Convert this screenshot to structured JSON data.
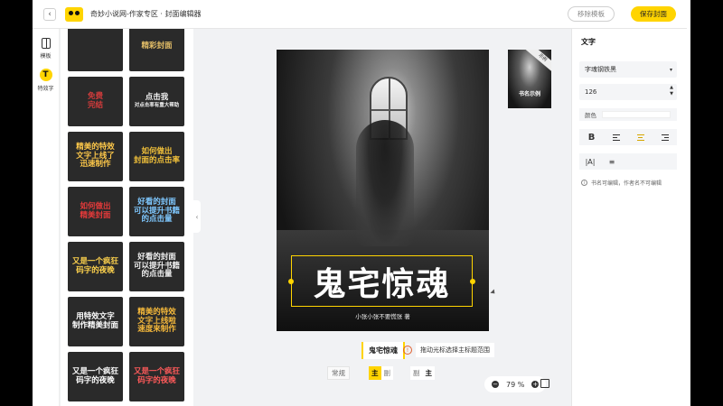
{
  "header": {
    "back": "‹",
    "title": "奇妙小说网-作家专区 · 封面编辑器",
    "remove_label": "移除模板",
    "save_label": "保存封面"
  },
  "rail": {
    "template_label": "模板",
    "text_icon": "T",
    "text_label": "特效字"
  },
  "templates": [
    {
      "lines": [
        "",
        ""
      ],
      "color": "#e8d9a8"
    },
    {
      "lines": [
        "精彩封面"
      ],
      "color": "#e6c068"
    },
    {
      "lines": [
        "免费",
        "完结"
      ],
      "color": "#d63c3c"
    },
    {
      "lines": [
        "点击我",
        "对点击率有重大帮助"
      ],
      "color": "#f2f2f2"
    },
    {
      "lines": [
        "精美的特效",
        "文字上线了",
        "迅速制作"
      ],
      "color": "#ffc94a"
    },
    {
      "lines": [
        "如何做出",
        "封面的点击率"
      ],
      "color": "#f3c23a"
    },
    {
      "lines": [
        "如何做出",
        "精美封面"
      ],
      "color": "#e83a3a"
    },
    {
      "lines": [
        "好看的封面",
        "可以提升书籍",
        "的点击量"
      ],
      "color": "#7fc8ff"
    },
    {
      "lines": [
        "又是一个疯狂",
        "码字的夜晚"
      ],
      "color": "#ffd34d"
    },
    {
      "lines": [
        "好看的封面",
        "可以提升书籍",
        "的点击量"
      ],
      "color": "#f0f0f0"
    },
    {
      "lines": [
        "用特效文字",
        "制作精美封面"
      ],
      "color": "#ffffff"
    },
    {
      "lines": [
        "精美的特效",
        "文字上线啦",
        "速度来制作"
      ],
      "color": "#f6b93b"
    },
    {
      "lines": [
        "又是一个疯狂",
        "码字的夜晚"
      ],
      "color": "#ffffff"
    },
    {
      "lines": [
        "又是一个疯狂",
        "码字的夜晚"
      ],
      "color": "#ff5a5a"
    }
  ],
  "canvas": {
    "title": "鬼宅惊魂",
    "author": "小张小张不要慌张 著",
    "thumb_ribbon": "示例",
    "thumb_title": "书名示例"
  },
  "toolbar": {
    "selected_text": "鬼宅惊魂",
    "info": "!",
    "hint": "拖动光标选择主标题范围",
    "mode_normal": "常规",
    "mode_main": "主",
    "mode_sub": "副",
    "mode_sub2": "副",
    "mode_main2": "主",
    "zoom_minus": "−",
    "zoom_value": "79 %",
    "zoom_plus": "+"
  },
  "panel": {
    "title": "文字",
    "font_value": "字魂钢铁黑",
    "font_caret": "▾",
    "size_value": "126",
    "color_label": "颜色",
    "bold": "B",
    "letter_spacing_icon": "|A|",
    "line_spacing_icon": "≡",
    "note": "书名可编辑，作者名不可编辑"
  },
  "colors": {
    "accent": "#ffd400"
  }
}
